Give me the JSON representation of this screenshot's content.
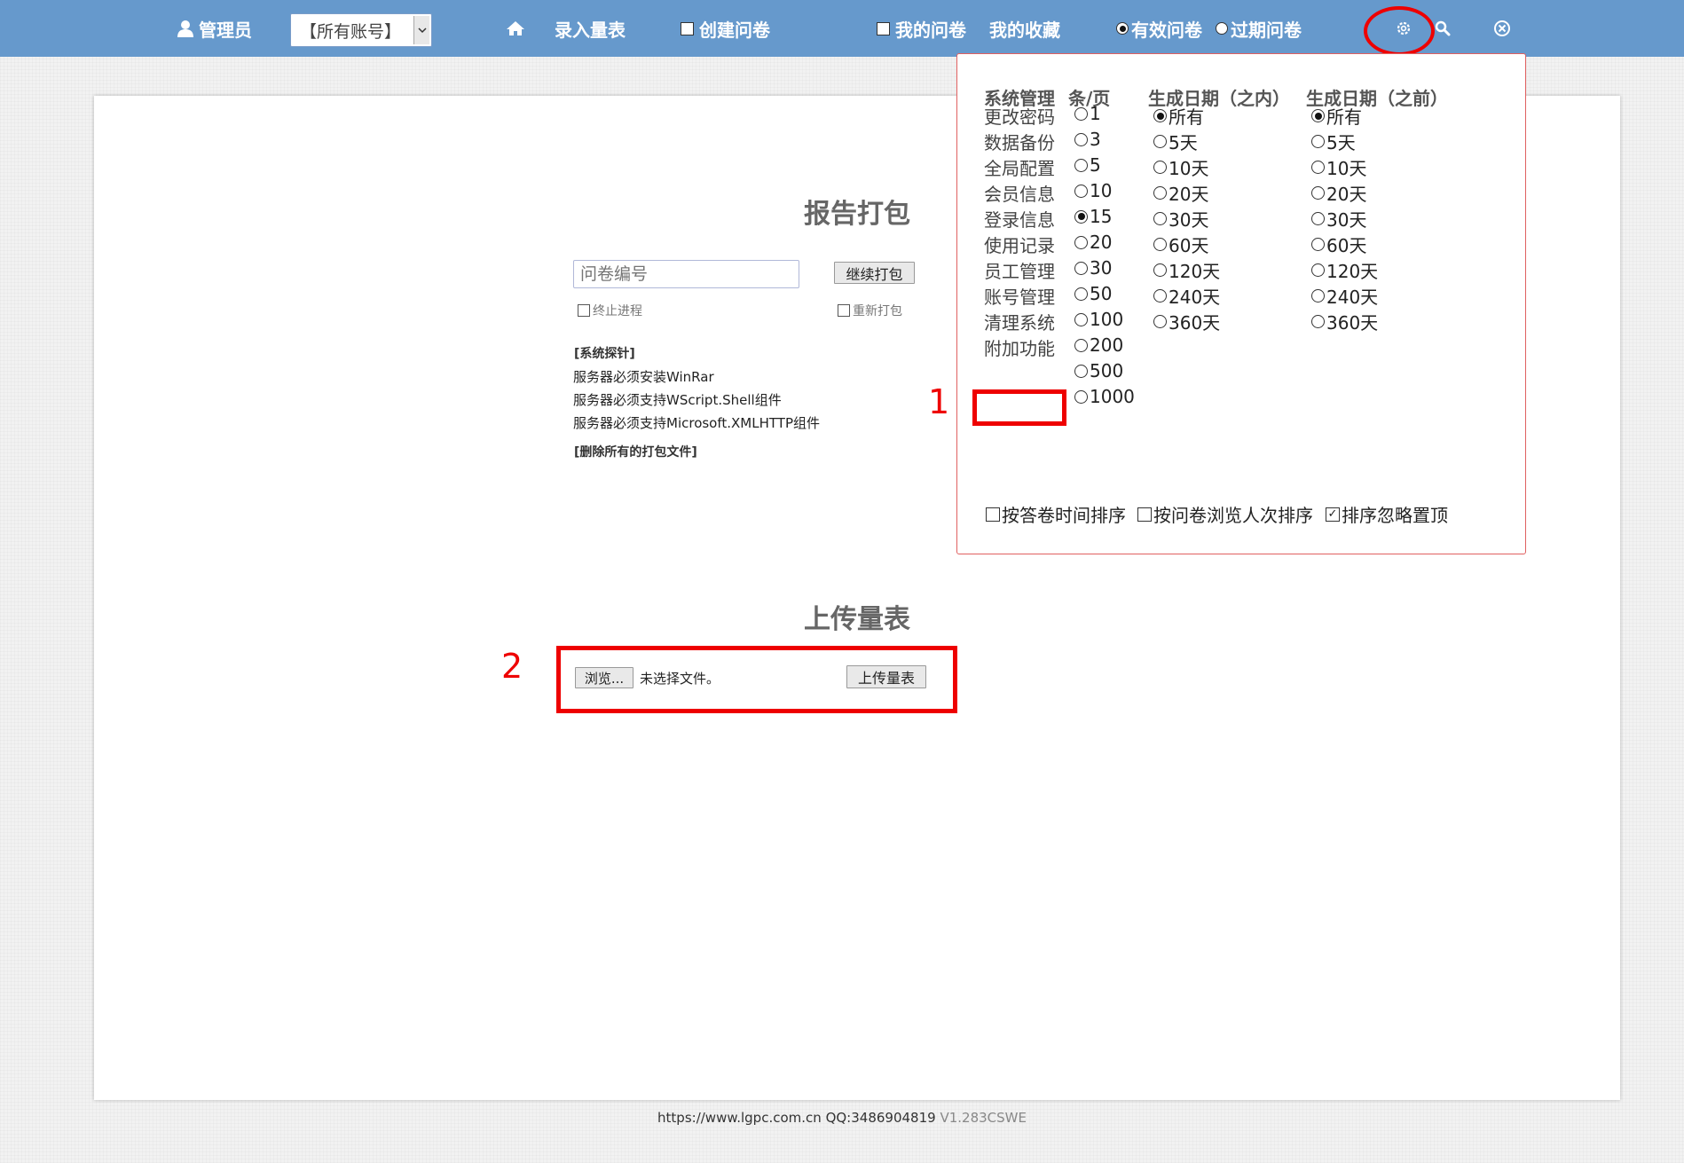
{
  "topbar": {
    "user_label": "管理员",
    "account_select": "【所有账号】",
    "enter_scale": "录入量表",
    "create_survey": "创建问卷",
    "my_surveys": "我的问卷",
    "my_favorites": "我的收藏",
    "valid_surveys": "有效问卷",
    "expired_surveys": "过期问卷"
  },
  "report": {
    "title": "报告打包",
    "input_placeholder": "问卷编号",
    "continue_button": "继续打包",
    "stop_process": "终止进程",
    "repack": "重新打包",
    "probe_title": "[系统探针]",
    "probe_lines": [
      "服务器必须安装WinRar",
      "服务器必须支持WScript.Shell组件",
      "服务器必须支持Microsoft.XMLHTTP组件"
    ],
    "delete_all": "[删除所有的打包文件]"
  },
  "upload": {
    "title": "上传量表",
    "browse_button": "浏览...",
    "no_file": "未选择文件。",
    "upload_button": "上传量表"
  },
  "annotations": {
    "label1": "1",
    "label2": "2"
  },
  "settings": {
    "headers": {
      "system": "系统管理",
      "per_page": "条/页",
      "date_within": "生成日期（之内）",
      "date_before": "生成日期（之前）"
    },
    "system_items": [
      "更改密码",
      "数据备份",
      "全局配置",
      "会员信息",
      "登录信息",
      "使用记录",
      "员工管理",
      "账号管理",
      "清理系统",
      "附加功能"
    ],
    "per_page_options": [
      "1",
      "3",
      "5",
      "10",
      "15",
      "20",
      "30",
      "50",
      "100",
      "200",
      "500",
      "1000"
    ],
    "per_page_selected": "15",
    "within_options": [
      "所有",
      "5天",
      "10天",
      "20天",
      "30天",
      "60天",
      "120天",
      "240天",
      "360天"
    ],
    "within_selected": "所有",
    "before_options": [
      "所有",
      "5天",
      "10天",
      "20天",
      "30天",
      "60天",
      "120天",
      "240天",
      "360天"
    ],
    "before_selected": "所有",
    "sort_by_answer_time": "按答卷时间排序",
    "sort_by_views": "按问卷浏览人次排序",
    "ignore_pinned": "排序忽略置顶",
    "ignore_pinned_checked": true
  },
  "footer": {
    "site": "https://www.lgpc.com.cn",
    "qq": "QQ:3486904819",
    "version": "V1.283CSWE"
  },
  "colors": {
    "topbar": "#6699cc",
    "annotation": "#ee0000"
  }
}
